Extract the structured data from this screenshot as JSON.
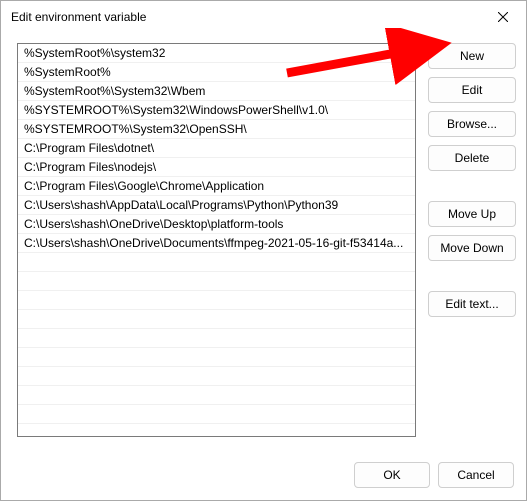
{
  "window": {
    "title": "Edit environment variable"
  },
  "paths": [
    "%SystemRoot%\\system32",
    "%SystemRoot%",
    "%SystemRoot%\\System32\\Wbem",
    "%SYSTEMROOT%\\System32\\WindowsPowerShell\\v1.0\\",
    "%SYSTEMROOT%\\System32\\OpenSSH\\",
    "C:\\Program Files\\dotnet\\",
    "C:\\Program Files\\nodejs\\",
    "C:\\Program Files\\Google\\Chrome\\Application",
    "C:\\Users\\shash\\AppData\\Local\\Programs\\Python\\Python39",
    "C:\\Users\\shash\\OneDrive\\Desktop\\platform-tools",
    "C:\\Users\\shash\\OneDrive\\Documents\\ffmpeg-2021-05-16-git-f53414a..."
  ],
  "buttons": {
    "new": "New",
    "edit": "Edit",
    "browse": "Browse...",
    "delete": "Delete",
    "moveup": "Move Up",
    "movedown": "Move Down",
    "edittext": "Edit text...",
    "ok": "OK",
    "cancel": "Cancel"
  },
  "annotation": {
    "arrow_color": "#ff0000",
    "points_to": "new-button"
  }
}
